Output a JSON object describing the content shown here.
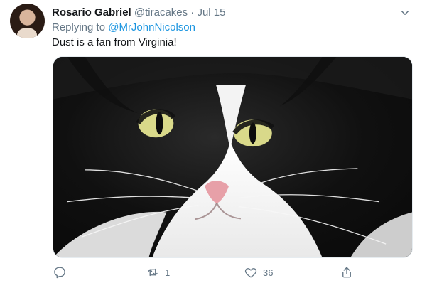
{
  "tweet": {
    "author_name": "Rosario Gabriel",
    "handle": "@tiracakes",
    "separator": "·",
    "date": "Jul 15",
    "replying_prefix": "Replying to",
    "replying_mention": "@MrJohnNicolson",
    "text": "Dust is a fan from Virginia!",
    "media_icon": "cat-photo",
    "actions": {
      "reply": {
        "icon": "reply-icon",
        "count": ""
      },
      "retweet": {
        "icon": "retweet-icon",
        "count": "1"
      },
      "like": {
        "icon": "heart-icon",
        "count": "36"
      },
      "share": {
        "icon": "share-icon",
        "count": ""
      }
    }
  }
}
